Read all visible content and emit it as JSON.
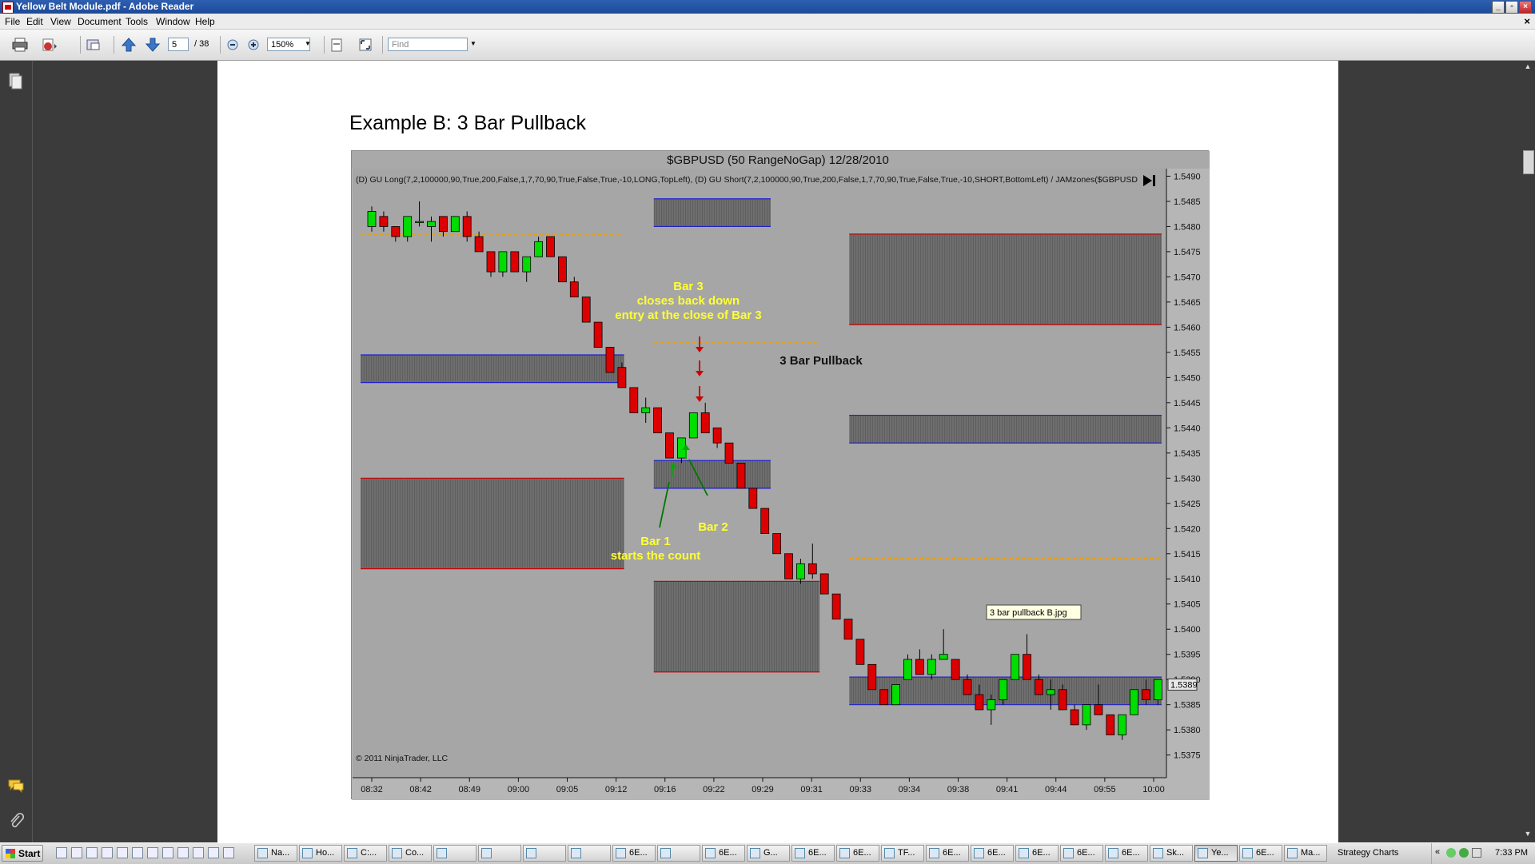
{
  "window": {
    "title": "Yellow Belt Module.pdf - Adobe Reader"
  },
  "menu": [
    "File",
    "Edit",
    "View",
    "Document",
    "Tools",
    "Window",
    "Help"
  ],
  "toolbar": {
    "page_current": "5",
    "page_total": "/ 38",
    "zoom": "150%",
    "find_placeholder": "Find"
  },
  "document": {
    "heading": "Example B:  3 Bar Pullback"
  },
  "chart_data": {
    "type": "candlestick",
    "title": "$GBPUSD (50 RangeNoGap)  12/28/2010",
    "indicator_label": "(D) GU Long(7,2,100000,90,True,200,False,1,7,70,90,True,False,True,-10,LONG,TopLeft), (D) GU Short(7,2,100000,90,True,200,False,1,7,70,90,True,False,True,-10,SHORT,BottomLeft) / JAMzones($GBPUSD",
    "copyright": "© 2011 NinjaTrader, LLC",
    "y_ticks": [
      "1.5490",
      "1.5485",
      "1.5480",
      "1.5475",
      "1.5470",
      "1.5465",
      "1.5460",
      "1.5455",
      "1.5450",
      "1.5445",
      "1.5440",
      "1.5435",
      "1.5430",
      "1.5425",
      "1.5420",
      "1.5415",
      "1.5410",
      "1.5405",
      "1.5400",
      "1.5395",
      "1.5390",
      "1.5385",
      "1.5380",
      "1.5375"
    ],
    "ylim": [
      1.53705,
      1.54915
    ],
    "x_ticks": [
      "08:32",
      "08:42",
      "08:49",
      "09:00",
      "09:05",
      "09:12",
      "09:16",
      "09:22",
      "09:29",
      "09:31",
      "09:33",
      "09:34",
      "09:38",
      "09:41",
      "09:44",
      "09:55",
      "10:00"
    ],
    "last_price": "1.5389",
    "last_price_value": 1.5389,
    "annotations": {
      "bar3_line1": "Bar 3",
      "bar3_line2": "closes back down",
      "bar3_line3": "entry at the close of Bar 3",
      "pullback_label": "3 Bar Pullback",
      "bar1_line1": "Bar 1",
      "bar1_line2": "starts the count",
      "bar2": "Bar 2",
      "tooltip": "3 bar pullback B.jpg"
    },
    "zones": [
      {
        "type": "grey",
        "top": 1.54855,
        "bottom": 1.548,
        "x_from": "09:16",
        "x_to": "09:29"
      },
      {
        "type": "grey",
        "top": 1.54785,
        "bottom": 1.54605,
        "x_from": "09:33",
        "x_to": "10:00"
      },
      {
        "type": "grey",
        "top": 1.54545,
        "bottom": 1.5449,
        "x_from": "08:32",
        "x_to": "09:12"
      },
      {
        "type": "grey",
        "top": 1.54425,
        "bottom": 1.5437,
        "x_from": "09:33",
        "x_to": "10:00"
      },
      {
        "type": "grey",
        "top": 1.54335,
        "bottom": 1.5428,
        "x_from": "09:16",
        "x_to": "09:29"
      },
      {
        "type": "grey",
        "top": 1.543,
        "bottom": 1.5412,
        "x_from": "08:32",
        "x_to": "09:12"
      },
      {
        "type": "grey",
        "top": 1.54095,
        "bottom": 1.53915,
        "x_from": "09:16",
        "x_to": "09:31"
      },
      {
        "type": "grey",
        "top": 1.53905,
        "bottom": 1.5385,
        "x_from": "09:33",
        "x_to": "10:00"
      }
    ],
    "orange_lines": [
      {
        "y": 1.54785,
        "x_from": "08:32",
        "x_to": "09:12"
      },
      {
        "y": 1.5457,
        "x_from": "09:16",
        "x_to": "09:31"
      },
      {
        "y": 1.5414,
        "x_from": "09:33",
        "x_to": "10:00"
      }
    ],
    "candles": [
      {
        "o": 1.548,
        "c": 1.5483,
        "h": 1.5484,
        "l": 1.5479
      },
      {
        "o": 1.5482,
        "c": 1.548,
        "h": 1.5483,
        "l": 1.5479
      },
      {
        "o": 1.548,
        "c": 1.5478,
        "h": 1.548,
        "l": 1.5477
      },
      {
        "o": 1.5478,
        "c": 1.5482,
        "h": 1.5482,
        "l": 1.5477
      },
      {
        "o": 1.5481,
        "c": 1.5481,
        "h": 1.5485,
        "l": 1.548
      },
      {
        "o": 1.548,
        "c": 1.5481,
        "h": 1.5482,
        "l": 1.5477
      },
      {
        "o": 1.5482,
        "c": 1.5479,
        "h": 1.5482,
        "l": 1.5478
      },
      {
        "o": 1.5479,
        "c": 1.5482,
        "h": 1.5482,
        "l": 1.5479
      },
      {
        "o": 1.5482,
        "c": 1.5478,
        "h": 1.5483,
        "l": 1.5477
      },
      {
        "o": 1.5478,
        "c": 1.5475,
        "h": 1.5479,
        "l": 1.5475
      },
      {
        "o": 1.5475,
        "c": 1.5471,
        "h": 1.5475,
        "l": 1.547
      },
      {
        "o": 1.5471,
        "c": 1.5475,
        "h": 1.5475,
        "l": 1.547
      },
      {
        "o": 1.5475,
        "c": 1.5471,
        "h": 1.5475,
        "l": 1.5471
      },
      {
        "o": 1.5471,
        "c": 1.5474,
        "h": 1.5474,
        "l": 1.5469
      },
      {
        "o": 1.5474,
        "c": 1.5477,
        "h": 1.5478,
        "l": 1.5474
      },
      {
        "o": 1.5478,
        "c": 1.5474,
        "h": 1.5478,
        "l": 1.5474
      },
      {
        "o": 1.5474,
        "c": 1.5469,
        "h": 1.5474,
        "l": 1.5469
      },
      {
        "o": 1.5469,
        "c": 1.5466,
        "h": 1.547,
        "l": 1.5466
      },
      {
        "o": 1.5466,
        "c": 1.5461,
        "h": 1.5466,
        "l": 1.5461
      },
      {
        "o": 1.5461,
        "c": 1.5456,
        "h": 1.5461,
        "l": 1.5456
      },
      {
        "o": 1.5456,
        "c": 1.5451,
        "h": 1.5456,
        "l": 1.5451
      },
      {
        "o": 1.5452,
        "c": 1.5448,
        "h": 1.5453,
        "l": 1.5448
      },
      {
        "o": 1.5448,
        "c": 1.5443,
        "h": 1.5448,
        "l": 1.5443
      },
      {
        "o": 1.5443,
        "c": 1.5444,
        "h": 1.5446,
        "l": 1.5441
      },
      {
        "o": 1.5444,
        "c": 1.5439,
        "h": 1.5444,
        "l": 1.5439
      },
      {
        "o": 1.5439,
        "c": 1.5434,
        "h": 1.5439,
        "l": 1.5434
      },
      {
        "o": 1.5434,
        "c": 1.5438,
        "h": 1.5438,
        "l": 1.5433
      },
      {
        "o": 1.5438,
        "c": 1.5443,
        "h": 1.5443,
        "l": 1.5438
      },
      {
        "o": 1.5443,
        "c": 1.5439,
        "h": 1.5445,
        "l": 1.5439
      },
      {
        "o": 1.544,
        "c": 1.5437,
        "h": 1.544,
        "l": 1.5436
      },
      {
        "o": 1.5437,
        "c": 1.5433,
        "h": 1.5437,
        "l": 1.5433
      },
      {
        "o": 1.5433,
        "c": 1.5428,
        "h": 1.5433,
        "l": 1.5428
      },
      {
        "o": 1.5428,
        "c": 1.5424,
        "h": 1.5428,
        "l": 1.5424
      },
      {
        "o": 1.5424,
        "c": 1.5419,
        "h": 1.5424,
        "l": 1.5419
      },
      {
        "o": 1.5419,
        "c": 1.5415,
        "h": 1.5419,
        "l": 1.5415
      },
      {
        "o": 1.5415,
        "c": 1.541,
        "h": 1.5415,
        "l": 1.541
      },
      {
        "o": 1.541,
        "c": 1.5413,
        "h": 1.5414,
        "l": 1.5409
      },
      {
        "o": 1.5413,
        "c": 1.5411,
        "h": 1.5417,
        "l": 1.541
      },
      {
        "o": 1.5411,
        "c": 1.5407,
        "h": 1.5411,
        "l": 1.5407
      },
      {
        "o": 1.5407,
        "c": 1.5402,
        "h": 1.5407,
        "l": 1.5402
      },
      {
        "o": 1.5402,
        "c": 1.5398,
        "h": 1.5402,
        "l": 1.5398
      },
      {
        "o": 1.5398,
        "c": 1.5393,
        "h": 1.5398,
        "l": 1.5393
      },
      {
        "o": 1.5393,
        "c": 1.5388,
        "h": 1.5393,
        "l": 1.5388
      },
      {
        "o": 1.5388,
        "c": 1.5385,
        "h": 1.5388,
        "l": 1.5385
      },
      {
        "o": 1.5385,
        "c": 1.5389,
        "h": 1.5389,
        "l": 1.5385
      },
      {
        "o": 1.539,
        "c": 1.5394,
        "h": 1.5395,
        "l": 1.539
      },
      {
        "o": 1.5394,
        "c": 1.5391,
        "h": 1.5396,
        "l": 1.5391
      },
      {
        "o": 1.5391,
        "c": 1.5394,
        "h": 1.5395,
        "l": 1.539
      },
      {
        "o": 1.5394,
        "c": 1.5395,
        "h": 1.54,
        "l": 1.5394
      },
      {
        "o": 1.5394,
        "c": 1.539,
        "h": 1.5394,
        "l": 1.539
      },
      {
        "o": 1.539,
        "c": 1.5387,
        "h": 1.5391,
        "l": 1.5387
      },
      {
        "o": 1.5387,
        "c": 1.5384,
        "h": 1.5389,
        "l": 1.5384
      },
      {
        "o": 1.5384,
        "c": 1.5386,
        "h": 1.5387,
        "l": 1.5381
      },
      {
        "o": 1.5386,
        "c": 1.539,
        "h": 1.539,
        "l": 1.5385
      },
      {
        "o": 1.539,
        "c": 1.5395,
        "h": 1.5395,
        "l": 1.539
      },
      {
        "o": 1.5395,
        "c": 1.539,
        "h": 1.5399,
        "l": 1.539
      },
      {
        "o": 1.539,
        "c": 1.5387,
        "h": 1.5391,
        "l": 1.5387
      },
      {
        "o": 1.5387,
        "c": 1.5388,
        "h": 1.539,
        "l": 1.5384
      },
      {
        "o": 1.5388,
        "c": 1.5384,
        "h": 1.5389,
        "l": 1.5384
      },
      {
        "o": 1.5384,
        "c": 1.5381,
        "h": 1.5385,
        "l": 1.5381
      },
      {
        "o": 1.5381,
        "c": 1.5385,
        "h": 1.5385,
        "l": 1.538
      },
      {
        "o": 1.5385,
        "c": 1.5383,
        "h": 1.5389,
        "l": 1.5383
      },
      {
        "o": 1.5383,
        "c": 1.5379,
        "h": 1.5383,
        "l": 1.5379
      },
      {
        "o": 1.5379,
        "c": 1.5383,
        "h": 1.5383,
        "l": 1.5378
      },
      {
        "o": 1.5383,
        "c": 1.5388,
        "h": 1.5388,
        "l": 1.5383
      },
      {
        "o": 1.5388,
        "c": 1.5386,
        "h": 1.539,
        "l": 1.5385
      },
      {
        "o": 1.5386,
        "c": 1.539,
        "h": 1.539,
        "l": 1.5385
      }
    ],
    "colors": {
      "up": "#00dd00",
      "down": "#dd0000",
      "annotation": "#ffff33",
      "zone": "#6e6e6e",
      "orange": "#e0a020",
      "blue": "#2020cc",
      "red": "#cc0000",
      "arrow_green": "#00aa00",
      "arrow_red": "#cc0000"
    }
  },
  "taskbar": {
    "start": "Start",
    "items": [
      "Na...",
      "Ho...",
      "C:...",
      "Co...",
      "",
      "",
      "",
      "",
      "6E...",
      "",
      "6E...",
      "G...",
      "6E...",
      "6E...",
      "TF...",
      "6E...",
      "6E...",
      "6E...",
      "6E...",
      "6E...",
      "Sk...",
      "Ye...",
      "6E...",
      "Ma..."
    ],
    "active_index": 21,
    "toolbar_label": "Strategy Charts",
    "clock": "7:33 PM"
  }
}
